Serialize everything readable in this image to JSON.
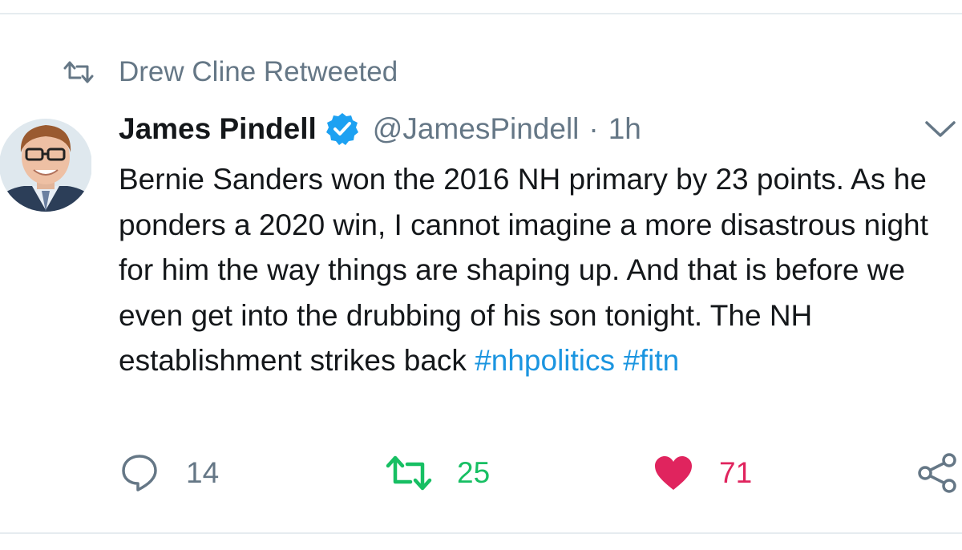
{
  "retweet_banner": {
    "icon": "retweet-icon",
    "text": "Drew Cline Retweeted"
  },
  "tweet": {
    "author_name": "James Pindell",
    "verified": true,
    "handle": "@JamesPindell",
    "separator": "·",
    "time": "1h",
    "text_plain": "Bernie Sanders won the 2016 NH primary by 23 points. As he ponders a 2020 win, I cannot imagine a more disastrous night for him the way things are shaping up. And that is before we even get into the drubbing of his son tonight. The NH establishment strikes back ",
    "hashtag_1": "#nhpolitics",
    "hashtag_space": " ",
    "hashtag_2": "#fitn"
  },
  "actions": {
    "reply_count": "14",
    "retweet_count": "25",
    "like_count": "71"
  },
  "colors": {
    "text": "#14171a",
    "muted": "#657786",
    "link": "#1b95e0",
    "retweet_green": "#17bf63",
    "like_red": "#e0245e",
    "verified_blue": "#1da1f2"
  }
}
